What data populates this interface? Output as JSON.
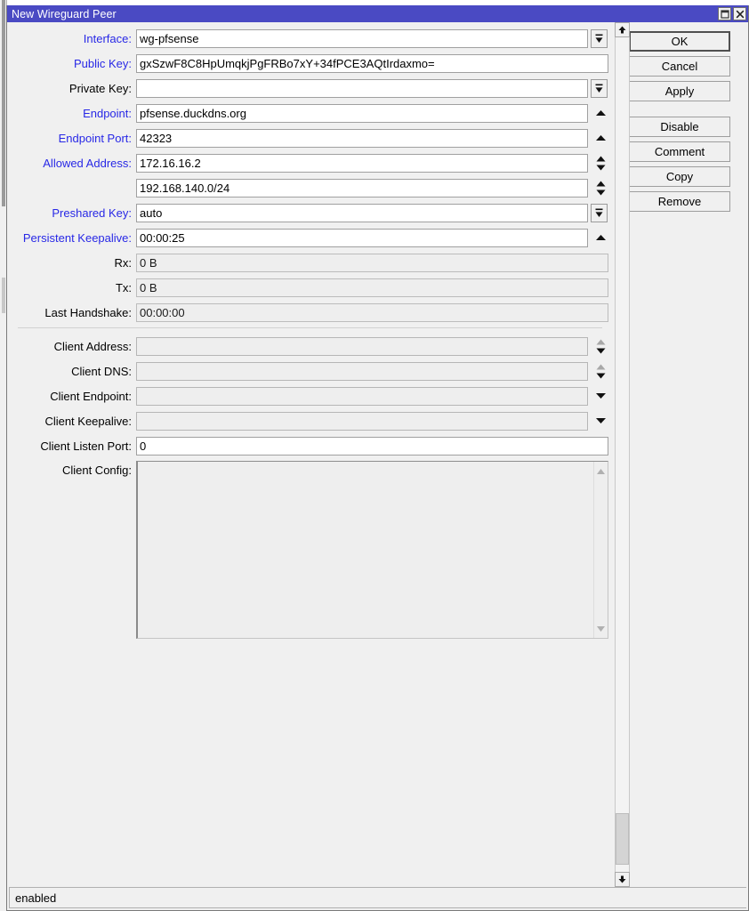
{
  "window": {
    "title": "New Wireguard Peer",
    "buttons": {
      "maximize": "maximize-restore",
      "close": "close"
    }
  },
  "form": {
    "rows": [
      {
        "label": "Interface:",
        "value": "wg-pfsense",
        "control": "dropdown",
        "readonly": false
      },
      {
        "label": "Public Key:",
        "value": "gxSzwF8C8HpUmqkjPgFRBo7xY+34fPCE3AQtIrdaxmo=",
        "control": "none",
        "readonly": false
      },
      {
        "label": "Private Key:",
        "value": "",
        "control": "dropdown",
        "readonly": false
      },
      {
        "label": "Endpoint:",
        "value": "pfsense.duckdns.org",
        "control": "up",
        "readonly": false
      },
      {
        "label": "Endpoint Port:",
        "value": "42323",
        "control": "up",
        "readonly": false
      },
      {
        "label": "Allowed Address:",
        "value": "172.16.16.2",
        "control": "updown",
        "readonly": false
      },
      {
        "label": "",
        "value": "192.168.140.0/24",
        "control": "updown",
        "readonly": false
      },
      {
        "label": "Preshared Key:",
        "value": "auto",
        "control": "dropdown",
        "readonly": false
      },
      {
        "label": "Persistent Keepalive:",
        "value": "00:00:25",
        "control": "up",
        "readonly": false
      },
      {
        "label": "Rx:",
        "value": "0 B",
        "control": "none",
        "readonly": true
      },
      {
        "label": "Tx:",
        "value": "0 B",
        "control": "none",
        "readonly": true
      },
      {
        "label": "Last Handshake:",
        "value": "00:00:00",
        "control": "none",
        "readonly": true
      }
    ],
    "client_rows": [
      {
        "label": "Client Address:",
        "value": "",
        "control": "updown-grey",
        "readonly": true
      },
      {
        "label": "Client DNS:",
        "value": "",
        "control": "updown-grey",
        "readonly": true
      },
      {
        "label": "Client Endpoint:",
        "value": "",
        "control": "down",
        "readonly": true
      },
      {
        "label": "Client Keepalive:",
        "value": "",
        "control": "down",
        "readonly": true
      },
      {
        "label": "Client Listen Port:",
        "value": "0",
        "control": "none",
        "readonly": false
      }
    ],
    "client_config": {
      "label": "Client Config:",
      "value": ""
    }
  },
  "actions": {
    "primary": "OK",
    "buttons_top": [
      "OK",
      "Cancel",
      "Apply"
    ],
    "buttons_bottom": [
      "Disable",
      "Comment",
      "Copy",
      "Remove"
    ]
  },
  "statusbar": {
    "text": "enabled"
  },
  "colors": {
    "titlebar": "#4a4ac3",
    "label_editable": "#2828e6",
    "label_readonly": "#000000",
    "dialog_bg": "#f0f0f0"
  }
}
